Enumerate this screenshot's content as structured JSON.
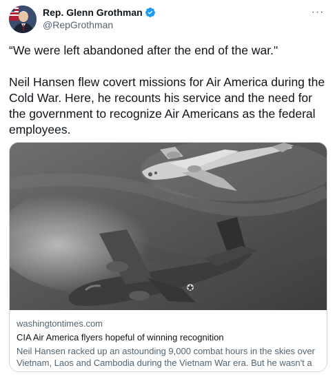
{
  "author": {
    "display_name": "Rep. Glenn Grothman",
    "handle": "@RepGrothman",
    "verified": true,
    "avatar_icon": "profile-photo"
  },
  "menu": {
    "icon": "more-icon",
    "label": "···"
  },
  "tweet": {
    "text": "“We were left abandoned after the end of the war.\"\n\nNeil Hansen flew covert missions for Air America during the Cold War. Here, he recounts his service and the need for the government to recognize Air Americans as the federal employees."
  },
  "card": {
    "domain": "washingtontimes.com",
    "title": "CIA Air America flyers hopeful of winning recognition",
    "description": "Neil Hansen racked up an astounding 9,000 combat hours in the skies over Vietnam, Laos and Cambodia during the Vietnam War era. But he wasn't a ..."
  },
  "colors": {
    "verified_blue": "#1d9bf0",
    "text_primary": "#0f1419",
    "text_secondary": "#536471",
    "border": "#cfd9de"
  }
}
